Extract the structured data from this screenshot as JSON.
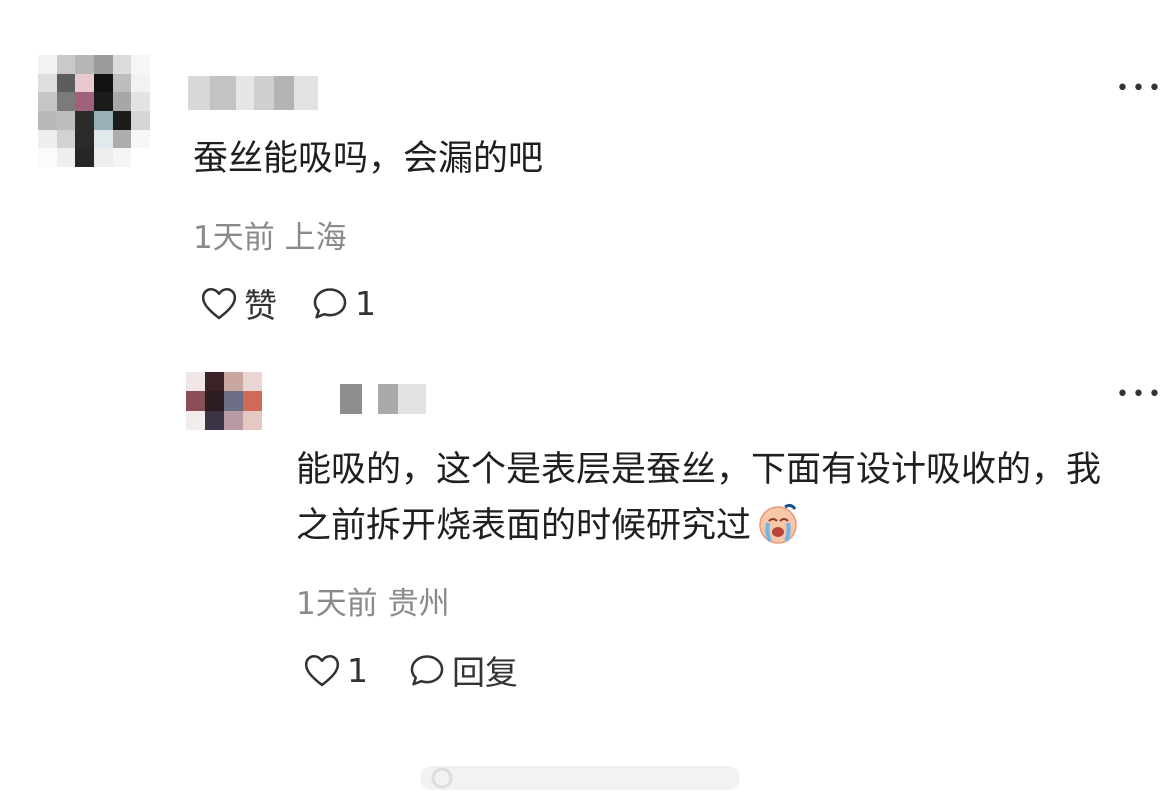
{
  "comments": {
    "main": {
      "text": "蚕丝能吸吗，会漏的吧",
      "time": "1天前",
      "location": "上海",
      "like_label": "赞",
      "reply_count": "1"
    },
    "reply": {
      "text": "能吸的，这个是表层是蚕丝，下面有设计吸收的，我之前拆开烧表面的时候研究过",
      "time": "1天前",
      "location": "贵州",
      "like_count": "1",
      "reply_label": "回复"
    }
  },
  "icons": {
    "more": "more-dots-icon",
    "like": "heart-outline-icon",
    "comment": "speech-bubble-icon",
    "emoji": "crying-face-emoji"
  },
  "colors": {
    "text": "#1f1f1f",
    "meta": "#8a8a8a",
    "background": "#ffffff"
  }
}
